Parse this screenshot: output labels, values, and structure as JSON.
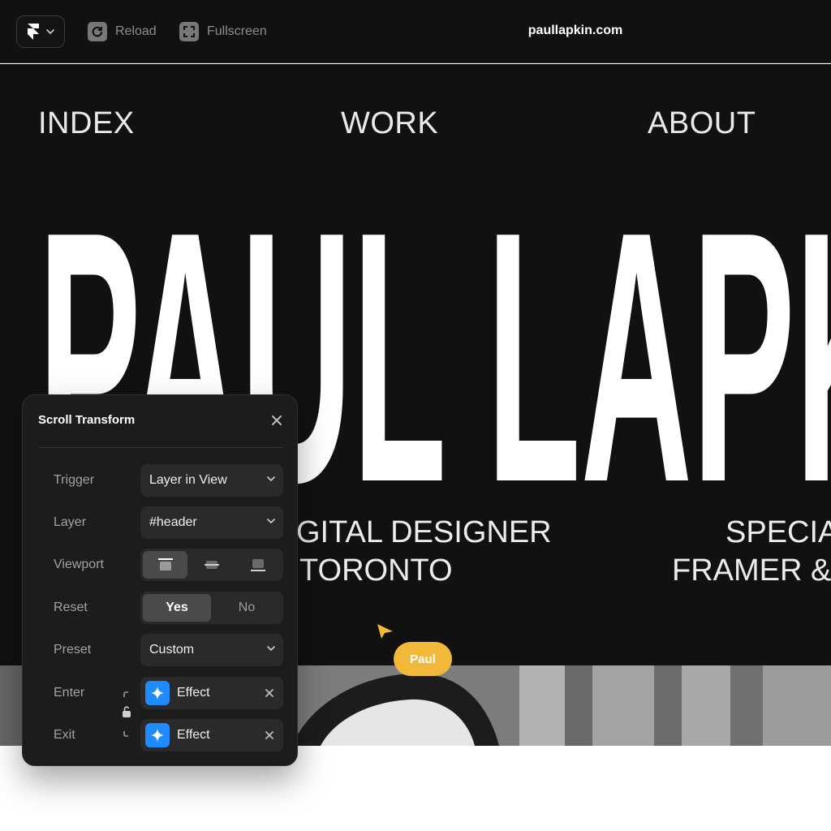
{
  "toolbar": {
    "logo_icon": "framer-logo-icon",
    "reload_label": "Reload",
    "fullscreen_label": "Fullscreen",
    "url": "paullapkin.com"
  },
  "site": {
    "nav": [
      "INDEX",
      "WORK",
      "ABOUT"
    ],
    "hero_name": "PAUL LAPKIN",
    "tagline_left": [
      "GITAL DESIGNER",
      "TORONTO"
    ],
    "tagline_right": [
      "SPECIA",
      "FRAMER &"
    ]
  },
  "cursor": {
    "name": "Paul",
    "color": "#f2b83a"
  },
  "panel": {
    "title": "Scroll Transform",
    "rows": {
      "trigger": {
        "label": "Trigger",
        "value": "Layer in View"
      },
      "layer": {
        "label": "Layer",
        "value": "#header"
      },
      "viewport": {
        "label": "Viewport",
        "options": [
          "viewport-top-icon",
          "viewport-center-icon",
          "viewport-bottom-icon"
        ],
        "selected": 0
      },
      "reset": {
        "label": "Reset",
        "options": [
          "Yes",
          "No"
        ],
        "selected": "Yes"
      },
      "preset": {
        "label": "Preset",
        "value": "Custom"
      },
      "enter": {
        "label": "Enter",
        "value": "Effect"
      },
      "exit": {
        "label": "Exit",
        "value": "Effect"
      }
    },
    "accent": "#1f8bff"
  }
}
